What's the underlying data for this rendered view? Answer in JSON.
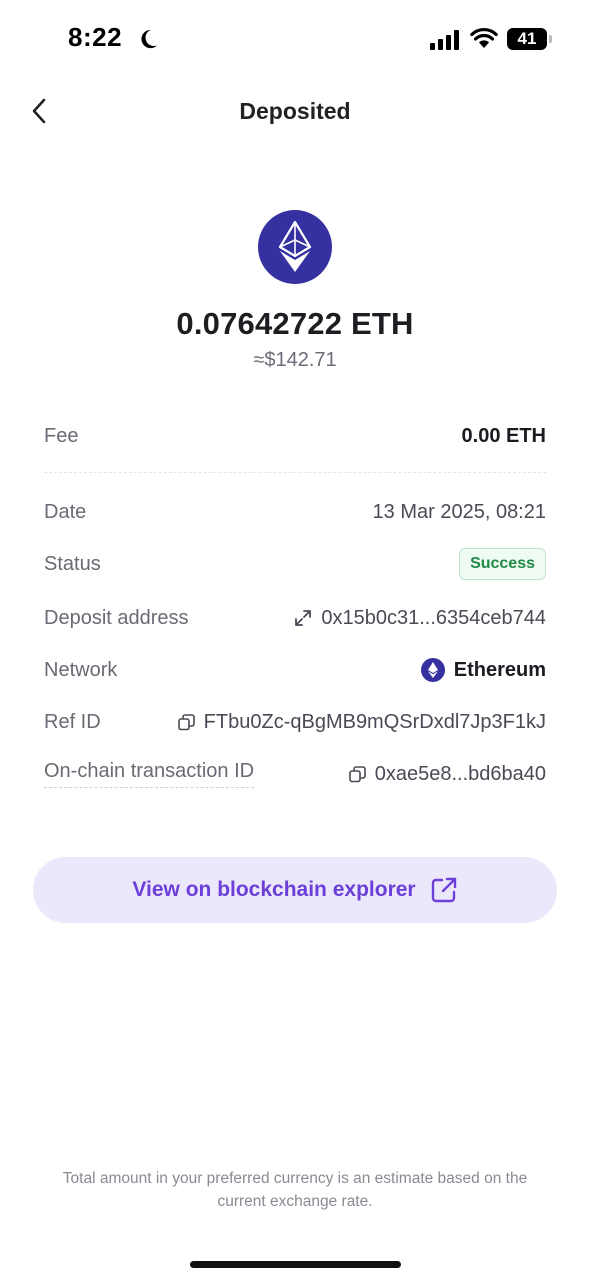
{
  "status_bar": {
    "time": "8:22",
    "battery": "41"
  },
  "header": {
    "title": "Deposited"
  },
  "coin": {
    "icon": "ethereum-icon",
    "color": "#3631a0"
  },
  "amount": {
    "crypto": "0.07642722 ETH",
    "fiat": "≈$142.71"
  },
  "details": {
    "fee": {
      "label": "Fee",
      "value": "0.00 ETH"
    },
    "date": {
      "label": "Date",
      "value": "13 Mar 2025, 08:21"
    },
    "status": {
      "label": "Status",
      "value": "Success",
      "color": "#1f8a47"
    },
    "deposit_address": {
      "label": "Deposit address",
      "value": "0x15b0c31...6354ceb744"
    },
    "network": {
      "label": "Network",
      "value": "Ethereum"
    },
    "ref_id": {
      "label": "Ref ID",
      "value": "FTbu0Zc-qBgMB9mQSrDxdl7Jp3F1kJ"
    },
    "tx_id": {
      "label": "On-chain transaction ID",
      "value": "0xae5e8...bd6ba40"
    }
  },
  "explorer_button": {
    "label": "View on blockchain explorer",
    "color": "#6c3fd9"
  },
  "footnote": "Total amount in your preferred currency is an estimate based on the current exchange rate."
}
